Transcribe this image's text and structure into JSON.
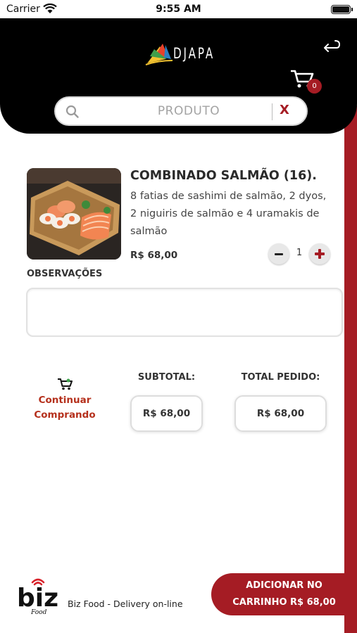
{
  "status_bar": {
    "carrier": "Carrier",
    "time": "9:55 AM"
  },
  "header": {
    "logo_text": "DJAPA",
    "cart_count": "0"
  },
  "search": {
    "placeholder": "PRODUTO",
    "clear_label": "X"
  },
  "product": {
    "title": "COMBINADO SALMÃO (16).",
    "description": "8 fatias de sashimi de salmão, 2 dyos, 2 niguiris de salmão e 4 uramakis de salmão",
    "price": "R$ 68,00",
    "quantity": "1"
  },
  "observations": {
    "label": "OBSERVAÇÕES",
    "value": ""
  },
  "totals": {
    "continue_line1": "Continuar",
    "continue_line2": "Comprando",
    "subtotal_label": "SUBTOTAL:",
    "subtotal_value": "R$ 68,00",
    "total_label": "TOTAL PEDIDO:",
    "total_value": "R$ 68,00"
  },
  "footer": {
    "brand_logo_text": "biz",
    "brand_logo_sub": "Food",
    "tagline": "Biz Food - Delivery on-line",
    "add_cart_line1": "ADICIONAR NO",
    "add_cart_line2": "CARRINHO R$ 68,00"
  },
  "colors": {
    "accent": "#a51c24",
    "header_bg": "#000000",
    "continue_text": "#b5301c"
  }
}
